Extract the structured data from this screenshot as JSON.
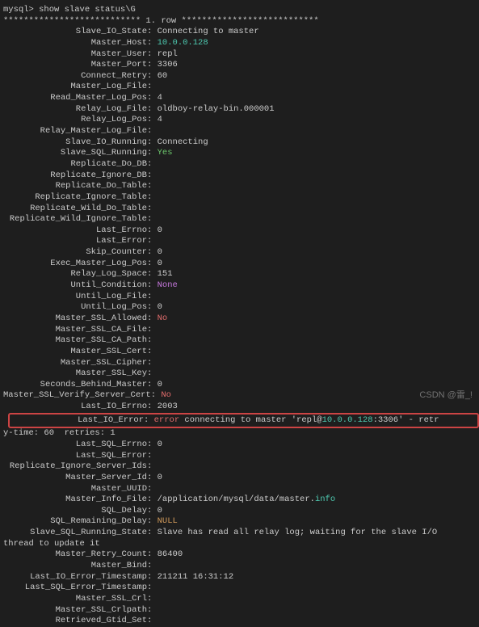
{
  "prompt": "mysql> show slave status\\G",
  "row_header": "*************************** 1. row ***************************",
  "fields": [
    {
      "label": "Slave_IO_State",
      "value": "Connecting to master",
      "cls": ""
    },
    {
      "label": "Master_Host",
      "value": "10.0.0.128",
      "cls": "cyan"
    },
    {
      "label": "Master_User",
      "value": "repl",
      "cls": ""
    },
    {
      "label": "Master_Port",
      "value": "3306",
      "cls": ""
    },
    {
      "label": "Connect_Retry",
      "value": "60",
      "cls": ""
    },
    {
      "label": "Master_Log_File",
      "value": "",
      "cls": ""
    },
    {
      "label": "Read_Master_Log_Pos",
      "value": "4",
      "cls": ""
    },
    {
      "label": "Relay_Log_File",
      "value": "oldboy-relay-bin.000001",
      "cls": ""
    },
    {
      "label": "Relay_Log_Pos",
      "value": "4",
      "cls": ""
    },
    {
      "label": "Relay_Master_Log_File",
      "value": "",
      "cls": ""
    },
    {
      "label": "Slave_IO_Running",
      "value": "Connecting",
      "cls": ""
    },
    {
      "label": "Slave_SQL_Running",
      "value": "Yes",
      "cls": "green"
    },
    {
      "label": "Replicate_Do_DB",
      "value": "",
      "cls": ""
    },
    {
      "label": "Replicate_Ignore_DB",
      "value": "",
      "cls": ""
    },
    {
      "label": "Replicate_Do_Table",
      "value": "",
      "cls": ""
    },
    {
      "label": "Replicate_Ignore_Table",
      "value": "",
      "cls": ""
    },
    {
      "label": "Replicate_Wild_Do_Table",
      "value": "",
      "cls": ""
    },
    {
      "label": "Replicate_Wild_Ignore_Table",
      "value": "",
      "cls": ""
    },
    {
      "label": "Last_Errno",
      "value": "0",
      "cls": ""
    },
    {
      "label": "Last_Error",
      "value": "",
      "cls": ""
    },
    {
      "label": "Skip_Counter",
      "value": "0",
      "cls": ""
    },
    {
      "label": "Exec_Master_Log_Pos",
      "value": "0",
      "cls": ""
    },
    {
      "label": "Relay_Log_Space",
      "value": "151",
      "cls": ""
    },
    {
      "label": "Until_Condition",
      "value": "None",
      "cls": "magenta"
    },
    {
      "label": "Until_Log_File",
      "value": "",
      "cls": ""
    },
    {
      "label": "Until_Log_Pos",
      "value": "0",
      "cls": ""
    },
    {
      "label": "Master_SSL_Allowed",
      "value": "No",
      "cls": "red"
    },
    {
      "label": "Master_SSL_CA_File",
      "value": "",
      "cls": ""
    },
    {
      "label": "Master_SSL_CA_Path",
      "value": "",
      "cls": ""
    },
    {
      "label": "Master_SSL_Cert",
      "value": "",
      "cls": ""
    },
    {
      "label": "Master_SSL_Cipher",
      "value": "",
      "cls": ""
    },
    {
      "label": "Master_SSL_Key",
      "value": "",
      "cls": ""
    },
    {
      "label": "Seconds_Behind_Master",
      "value": "0",
      "cls": ""
    },
    {
      "label": "Master_SSL_Verify_Server_Cert",
      "value": "No",
      "cls": "red"
    },
    {
      "label": "Last_IO_Errno",
      "value": "2003",
      "cls": ""
    }
  ],
  "highlight": {
    "line1_label": "Last_IO_Error",
    "line1_pre": ": ",
    "line1_err": "error",
    "line1_mid": " connecting to master 'repl@",
    "line1_ip": "10.0.0.128",
    "line1_suffix": ":3306' - retr",
    "line2_pre": "y-time: 60  re",
    "line2_in": "tries: 1"
  },
  "fields_after": [
    {
      "label": "Last_SQL_Errno",
      "value": "0",
      "cls": ""
    },
    {
      "label": "Last_SQL_Error",
      "value": "",
      "cls": ""
    },
    {
      "label": "Replicate_Ignore_Server_Ids",
      "value": "",
      "cls": ""
    },
    {
      "label": "Master_Server_Id",
      "value": "0",
      "cls": ""
    },
    {
      "label": "Master_UUID",
      "value": "",
      "cls": ""
    }
  ],
  "master_info_file": {
    "label": "Master_Info_File",
    "pre": "/application/mysql/data/master.",
    "ext": "info"
  },
  "fields_tail1": [
    {
      "label": "SQL_Delay",
      "value": "0",
      "cls": ""
    },
    {
      "label": "SQL_Remaining_Delay",
      "value": "NULL",
      "cls": "orange"
    }
  ],
  "running_state": {
    "label": "Slave_SQL_Running_State",
    "line1": "Slave has read all relay log; waiting for the slave I/O",
    "line2": "thread to update it"
  },
  "fields_tail2": [
    {
      "label": "Master_Retry_Count",
      "value": "86400",
      "cls": ""
    },
    {
      "label": "Master_Bind",
      "value": "",
      "cls": ""
    },
    {
      "label": "Last_IO_Error_Timestamp",
      "value": "211211 16:31:12",
      "cls": ""
    },
    {
      "label": "Last_SQL_Error_Timestamp",
      "value": "",
      "cls": ""
    },
    {
      "label": "Master_SSL_Crl",
      "value": "",
      "cls": ""
    },
    {
      "label": "Master_SSL_Crlpath",
      "value": "",
      "cls": ""
    },
    {
      "label": "Retrieved_Gtid_Set",
      "value": "",
      "cls": ""
    }
  ],
  "watermark": "CSDN @雷_!"
}
